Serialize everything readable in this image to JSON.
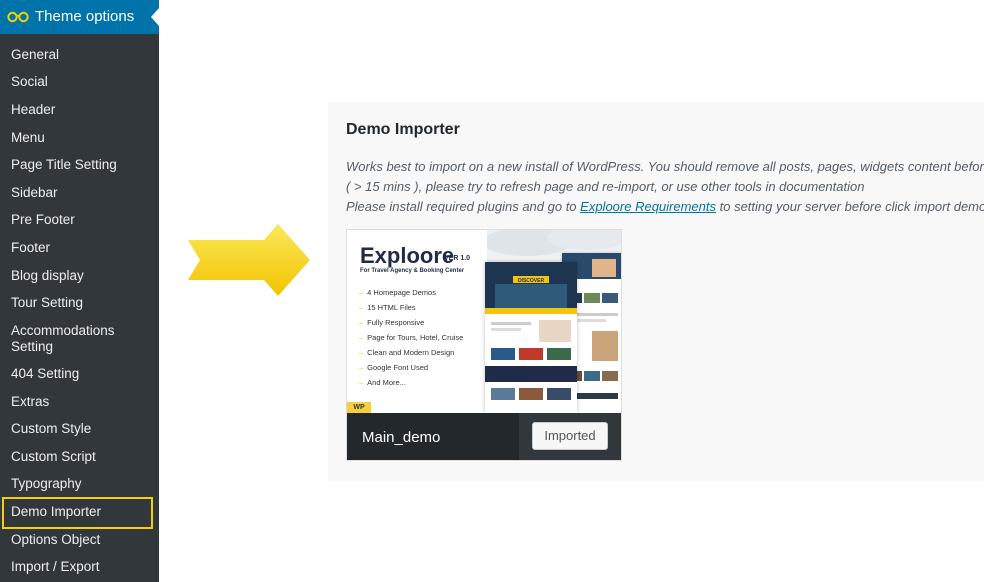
{
  "sidebar": {
    "title": "Theme options",
    "logo_icon": "glasses-icon",
    "items": [
      {
        "label": "General"
      },
      {
        "label": "Social"
      },
      {
        "label": "Header"
      },
      {
        "label": "Menu"
      },
      {
        "label": "Page Title Setting"
      },
      {
        "label": "Sidebar"
      },
      {
        "label": "Pre Footer"
      },
      {
        "label": "Footer"
      },
      {
        "label": "Blog display"
      },
      {
        "label": "Tour Setting"
      },
      {
        "label": "Accommodations Setting"
      },
      {
        "label": "404 Setting"
      },
      {
        "label": "Extras"
      },
      {
        "label": "Custom Style"
      },
      {
        "label": "Custom Script"
      },
      {
        "label": "Typography"
      },
      {
        "label": "Demo Importer"
      },
      {
        "label": "Options Object"
      },
      {
        "label": "Import / Export"
      }
    ],
    "active_item": "Demo Importer",
    "highlight_color": "#f1d206"
  },
  "panel": {
    "title": "Demo Importer",
    "desc_line1": "Works best to import on a new install of WordPress. You should remove all posts, pages, widgets content before",
    "desc_line2": "( > 15 mins ), please try to refresh page and re-import, or use other tools in documentation",
    "desc_line3_before": "Please install required plugins and go to ",
    "desc_link": "Exploore Requirements",
    "desc_line3_after": " to setting your server before click import demo."
  },
  "demo": {
    "name": "Main_demo",
    "button_label": "Imported",
    "thumbnail": {
      "brand": "Exploore",
      "version": "VER 1.0",
      "tagline": "For Travel Agency & Booking Center",
      "features": [
        "4 Homepage Demos",
        "15 HTML Files",
        "Fully Responsive",
        "Page for Tours, Hotel, Cruise",
        "Clean and Modern Design",
        "Google Font Used",
        "And More..."
      ],
      "badge": "WP",
      "screenshot_heading": "DISCOVER"
    }
  },
  "colors": {
    "sidebar_bg": "#32373c",
    "header_bg": "#0073aa",
    "arrow": "#f7d716",
    "link": "#0073aa"
  }
}
